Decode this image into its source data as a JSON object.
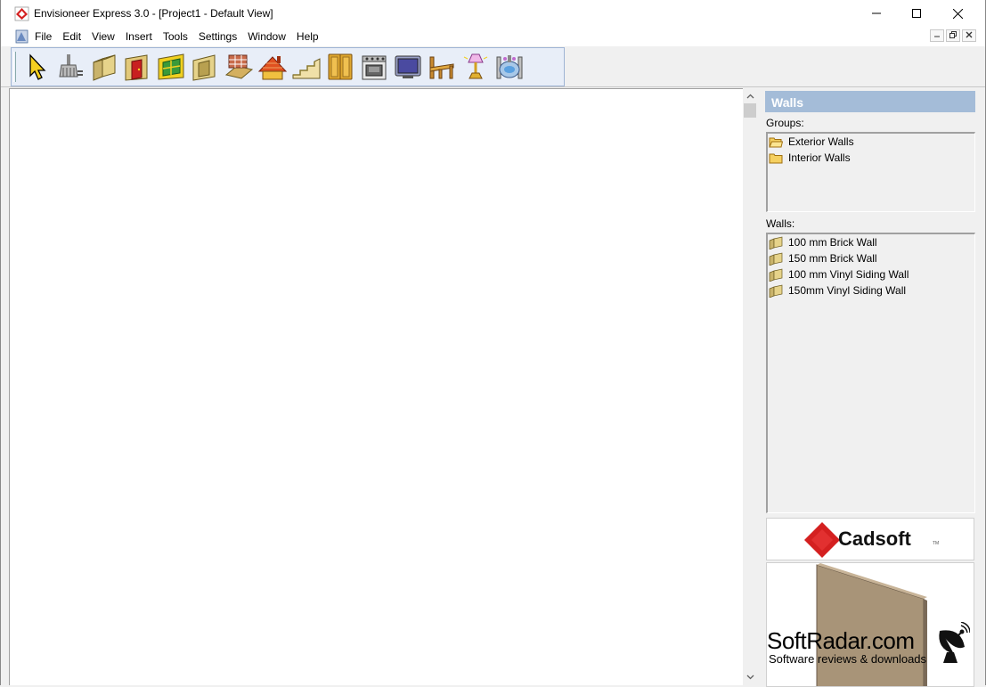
{
  "window": {
    "title": "Envisioneer Express 3.0 - [Project1 - Default View]"
  },
  "menu": {
    "items": [
      "File",
      "Edit",
      "View",
      "Insert",
      "Tools",
      "Settings",
      "Window",
      "Help"
    ]
  },
  "toolbar": {
    "tools": [
      {
        "name": "select-tool",
        "icon": "arrow-cursor-icon"
      },
      {
        "name": "sweep-tool",
        "icon": "brush-icon"
      },
      {
        "name": "walls-tool",
        "icon": "wall-icon"
      },
      {
        "name": "doors-tool",
        "icon": "door-icon"
      },
      {
        "name": "windows-tool",
        "icon": "window-icon"
      },
      {
        "name": "openings-tool",
        "icon": "opening-icon"
      },
      {
        "name": "floors-tool",
        "icon": "floor-icon"
      },
      {
        "name": "roofs-tool",
        "icon": "roof-icon"
      },
      {
        "name": "stairs-tool",
        "icon": "stairs-icon"
      },
      {
        "name": "cabinets-tool",
        "icon": "cabinet-icon"
      },
      {
        "name": "appliances-tool",
        "icon": "stove-icon"
      },
      {
        "name": "electronics-tool",
        "icon": "tv-icon"
      },
      {
        "name": "furniture-tool",
        "icon": "bench-icon"
      },
      {
        "name": "lighting-tool",
        "icon": "lamp-icon"
      },
      {
        "name": "plumbing-tool",
        "icon": "sink-icon"
      }
    ]
  },
  "panel": {
    "title": "Walls",
    "groups_label": "Groups:",
    "groups": [
      "Exterior Walls",
      "Interior Walls"
    ],
    "walls_label": "Walls:",
    "walls": [
      "100 mm Brick Wall",
      "150 mm Brick Wall",
      "100 mm Vinyl Siding Wall",
      "150mm Vinyl Siding Wall"
    ],
    "logo_text": "Cadsoft",
    "logo_tm": "TM"
  },
  "watermark": {
    "name": "SoftRadar.com",
    "tagline": "Software reviews & downloads"
  },
  "colors": {
    "panel_header": "#a4bcd8",
    "logo_red": "#d42020",
    "toolbar_bg": "#e8eef8"
  }
}
